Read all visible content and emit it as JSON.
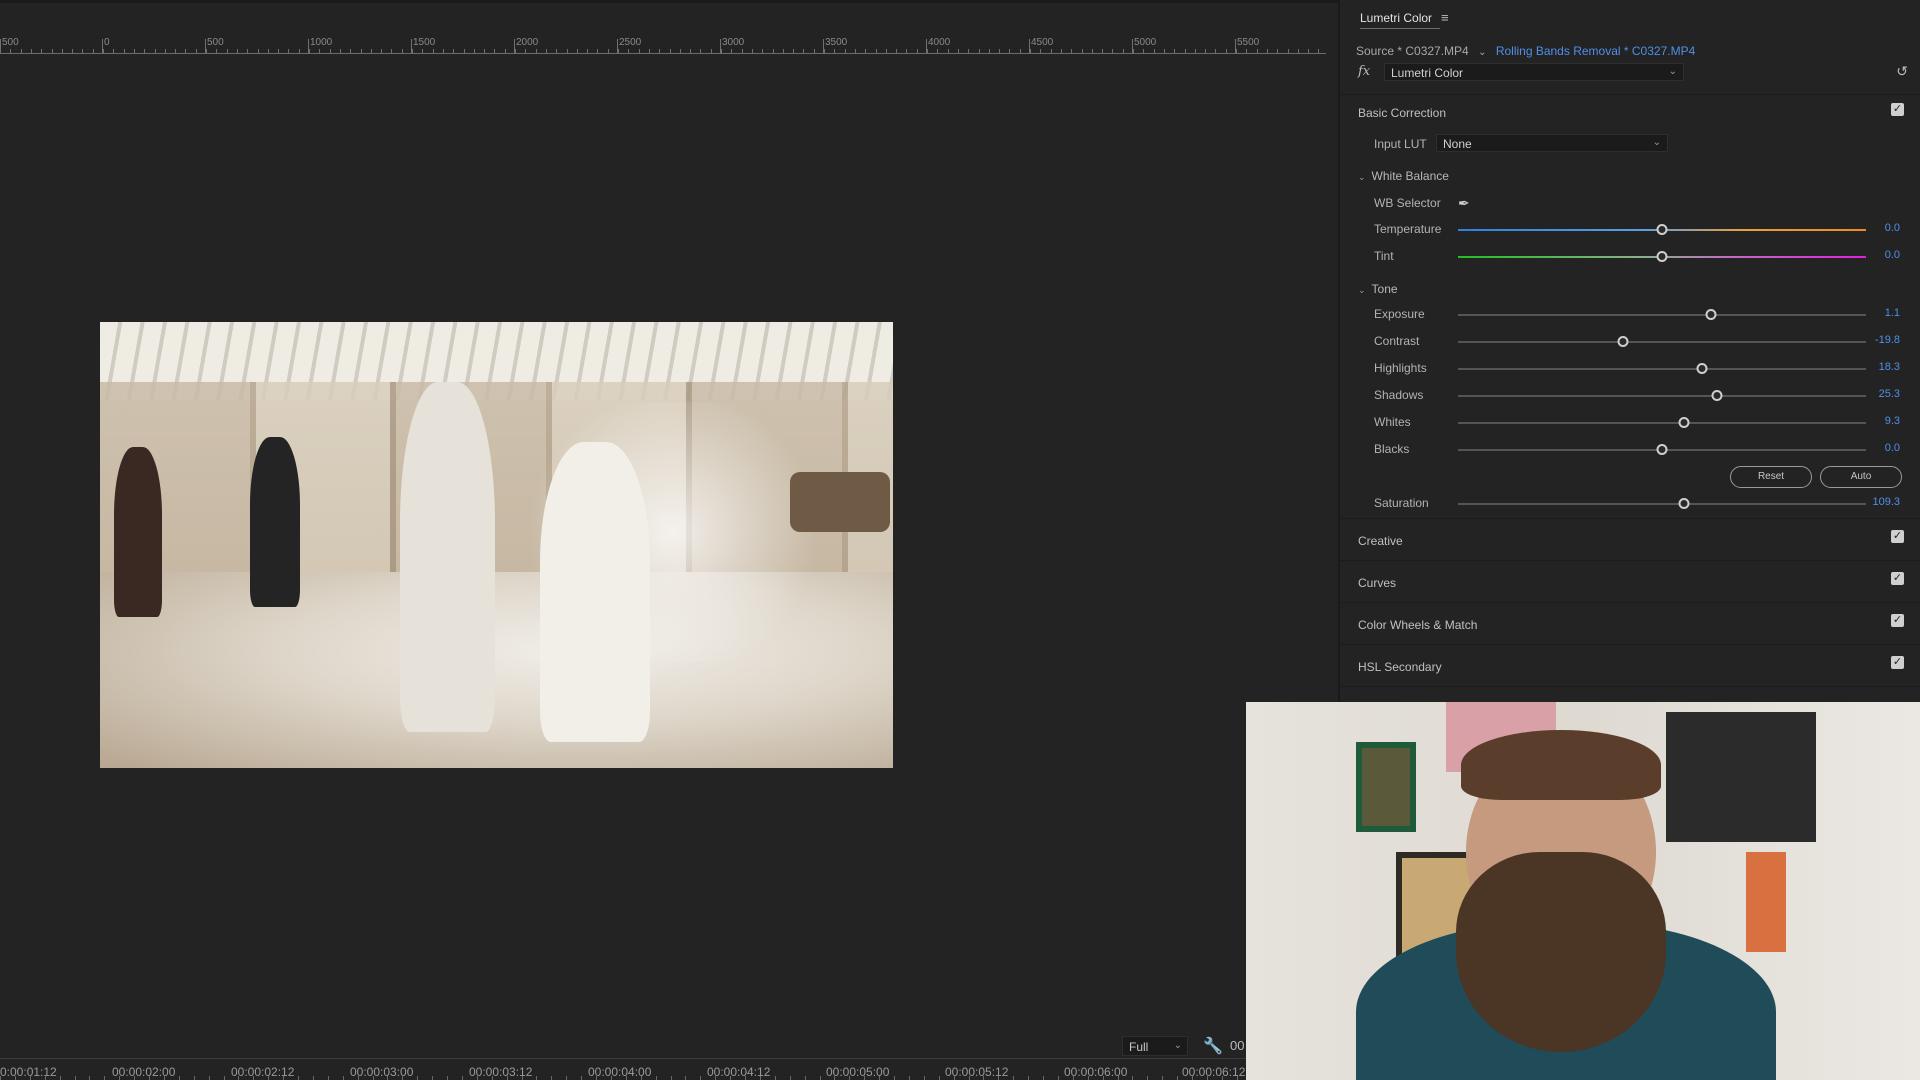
{
  "ruler": {
    "labels": [
      "500",
      "0",
      "500",
      "1000",
      "1500",
      "2000",
      "2500",
      "3000",
      "3500",
      "4000",
      "4500",
      "5000",
      "5500"
    ]
  },
  "timecodes": [
    "0:00:01:12",
    "00:00:02:00",
    "00:00:02:12",
    "00:00:03:00",
    "00:00:03:12",
    "00:00:04:00",
    "00:00:04:12",
    "00:00:05:00",
    "00:00:05:12",
    "00:00:06:00",
    "00:00:06:12"
  ],
  "monitor": {
    "resolution": "Full",
    "timecode_cut": "00"
  },
  "panel": {
    "tab_title": "Lumetri Color",
    "menu_icon": "hamburger-icon",
    "source_label": "Source * C0327.MP4",
    "clip_label": "Rolling Bands Removal * C0327.MP4",
    "fx_effect": "Lumetri Color",
    "sections": {
      "basic": "Basic Correction",
      "creative": "Creative",
      "curves": "Curves",
      "wheels": "Color Wheels & Match",
      "hsl": "HSL Secondary"
    },
    "input_lut_label": "Input LUT",
    "input_lut_value": "None",
    "white_balance": "White Balance",
    "wb_selector": "WB Selector",
    "tone": "Tone",
    "reset_label": "Reset",
    "auto_label": "Auto",
    "sliders": [
      {
        "name": "Temperature",
        "value": "0.0",
        "level": 0.5
      },
      {
        "name": "Tint",
        "value": "0.0",
        "level": 0.5
      },
      {
        "name": "Exposure",
        "value": "1.1",
        "level": 0.62
      },
      {
        "name": "Contrast",
        "value": "-19.8",
        "level": 0.405
      },
      {
        "name": "Highlights",
        "value": "18.3",
        "level": 0.598
      },
      {
        "name": "Shadows",
        "value": "25.3",
        "level": 0.635
      },
      {
        "name": "Whites",
        "value": "9.3",
        "level": 0.553
      },
      {
        "name": "Blacks",
        "value": "0.0",
        "level": 0.5
      },
      {
        "name": "Saturation",
        "value": "109.3",
        "level": 0.553
      }
    ]
  },
  "colors": {
    "accent": "#4f8fe8",
    "panel_bg": "#232323"
  }
}
